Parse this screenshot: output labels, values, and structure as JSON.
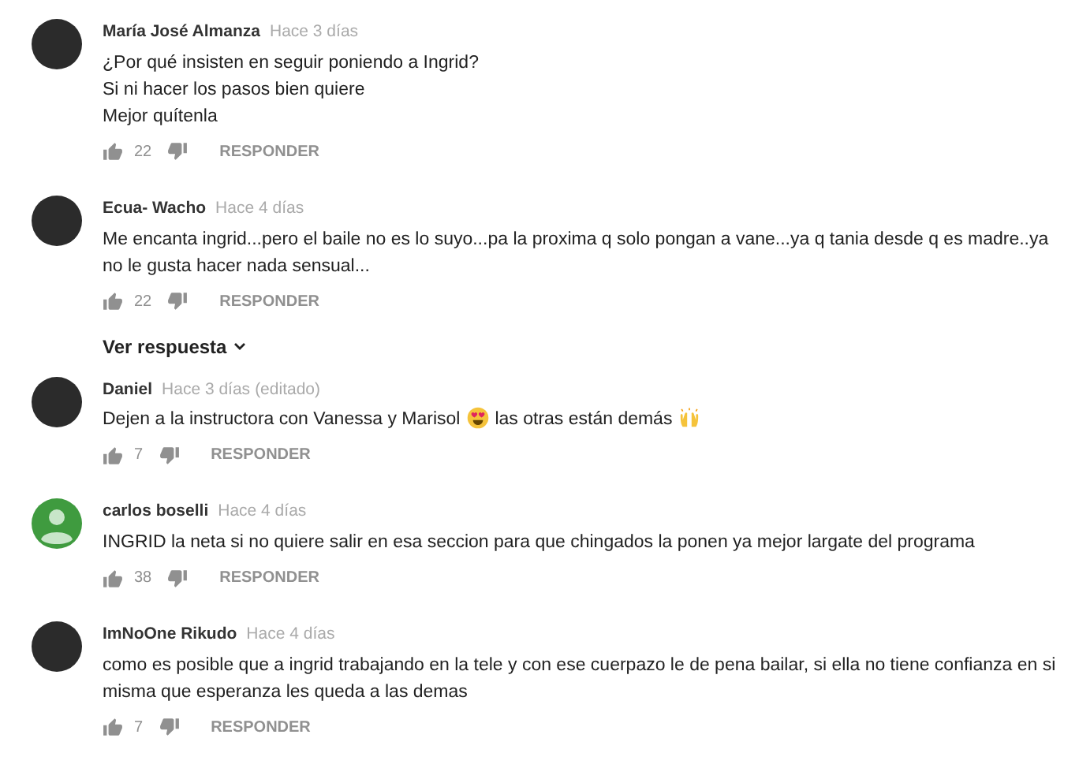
{
  "comments": [
    {
      "author": "María José Almanza",
      "time": "Hace 3 días",
      "avatar": {
        "kind": "photo"
      },
      "body": [
        [
          {
            "kind": "text",
            "text": "¿Por qué insisten en seguir poniendo a Ingrid?"
          }
        ],
        [
          {
            "kind": "text",
            "text": "Si ni hacer los pasos bien quiere"
          }
        ],
        [
          {
            "kind": "text",
            "text": "Mejor quítenla"
          }
        ]
      ],
      "likes": "22",
      "reply": "RESPONDER"
    },
    {
      "author": "Ecua- Wacho",
      "time": "Hace 4 días",
      "avatar": {
        "kind": "photo"
      },
      "body": [
        [
          {
            "kind": "text",
            "text": "Me encanta ingrid...pero el baile no es lo suyo...pa la proxima q solo pongan a vane...ya q tania desde q es madre..ya no le gusta hacer nada sensual..."
          }
        ]
      ],
      "likes": "22",
      "reply": "RESPONDER",
      "replies_link": "Ver respuesta"
    },
    {
      "author": "Daniel",
      "time": "Hace 3 días",
      "edited": "(editado)",
      "avatar": {
        "kind": "photo"
      },
      "body": [
        [
          {
            "kind": "text",
            "text": "Dejen a la instructora con Vanessa y Marisol"
          },
          {
            "kind": "heart-eyes"
          },
          {
            "kind": "text",
            "text": "las otras están demás"
          },
          {
            "kind": "raised-hands"
          }
        ]
      ],
      "likes": "7",
      "reply": "RESPONDER"
    },
    {
      "author": "carlos boselli",
      "time": "Hace 4 días",
      "avatar": {
        "kind": "default"
      },
      "body": [
        [
          {
            "kind": "text",
            "text": "INGRID la neta si no quiere salir en esa seccion para que chingados la ponen ya mejor largate del programa"
          }
        ]
      ],
      "likes": "38",
      "reply": "RESPONDER"
    },
    {
      "author": "ImNoOne Rikudo",
      "time": "Hace 4 días",
      "avatar": {
        "kind": "photo"
      },
      "body": [
        [
          {
            "kind": "text",
            "text": "como es posible que a  ingrid trabajando en la tele y con ese cuerpazo le de pena bailar, si ella no tiene confianza en si misma que esperanza les queda a las demas"
          }
        ]
      ],
      "likes": "7",
      "reply": "RESPONDER"
    }
  ]
}
